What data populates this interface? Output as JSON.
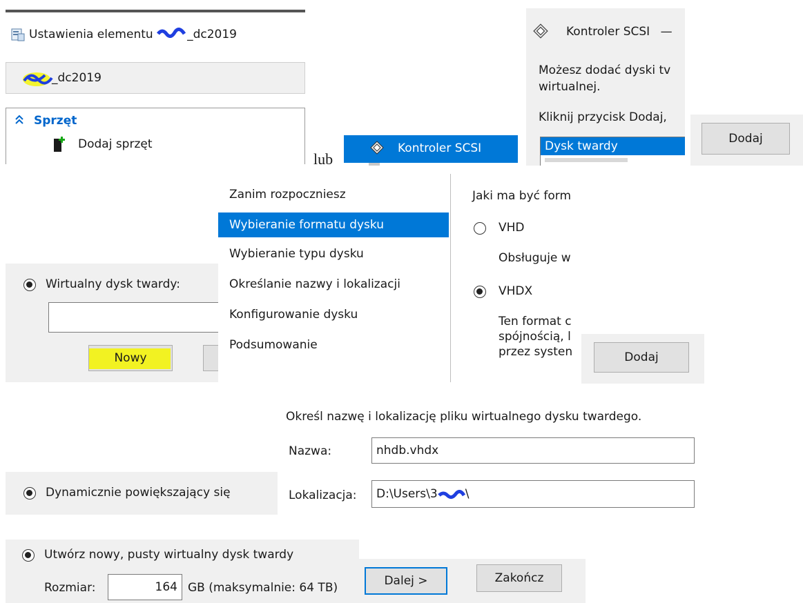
{
  "settings_panel": {
    "title_prefix": "Ustawienia elementu ",
    "title_suffix": "_dc2019",
    "vm_name_suffix": "_dc2019",
    "section_label": "Sprzęt",
    "add_hardware_label": "Dodaj sprzęt"
  },
  "connector_text": "lub",
  "scsi_tree_item": {
    "label": "Kontroler SCSI"
  },
  "scsi_panel": {
    "title": "Kontroler SCSI",
    "title_dash": "—",
    "description_line1": "Możesz dodać dyski tv",
    "description_line2": "wirtualnej.",
    "instruction": "Kliknij przycisk Dodaj,",
    "list_selected": "Dysk twardy",
    "add_button": "Dodaj"
  },
  "virtual_disk_panel": {
    "radio_label": "Wirtualny dysk twardy:",
    "path_value": "",
    "new_button": "Nowy",
    "highlight_color": "#f5f500"
  },
  "wizard_nav": {
    "items": [
      {
        "label": "Zanim rozpoczniesz",
        "selected": false
      },
      {
        "label": "Wybieranie formatu dysku",
        "selected": true
      },
      {
        "label": "Wybieranie typu dysku",
        "selected": false
      },
      {
        "label": "Określanie nazwy i lokalizacji",
        "selected": false
      },
      {
        "label": "Konfigurowanie dysku",
        "selected": false
      },
      {
        "label": "Podsumowanie",
        "selected": false
      }
    ]
  },
  "format_panel": {
    "question": "Jaki ma być form",
    "vhd_label": "VHD",
    "vhd_desc": "Obsługuje w",
    "vhdx_label": "VHDX",
    "vhdx_desc_line1": "Ten format c",
    "vhdx_desc_line2": "spójnością, l",
    "vhdx_desc_line3": "przez systen",
    "add_button": "Dodaj"
  },
  "name_location_panel": {
    "heading": "Określ nazwę i lokalizację pliku wirtualnego dysku twardego.",
    "name_label": "Nazwa:",
    "name_value": "nhdb.vhdx",
    "location_label": "Lokalizacja:",
    "location_value_prefix": "D:\\Users\\3",
    "location_value_suffix": "\\"
  },
  "dynamic_panel": {
    "radio_label": "Dynamicznie powiększający się"
  },
  "create_panel": {
    "radio_label": "Utwórz nowy, pusty wirtualny dysk twardy",
    "size_label": "Rozmiar:",
    "size_value": "164",
    "size_unit": "GB (maksymalnie: 64 TB)"
  },
  "footer_buttons": {
    "next": "Dalej >",
    "finish": "Zakończ"
  },
  "colors": {
    "accent": "#0078d7",
    "redaction": "#1f3fe0",
    "section_blue": "#0066cc"
  }
}
